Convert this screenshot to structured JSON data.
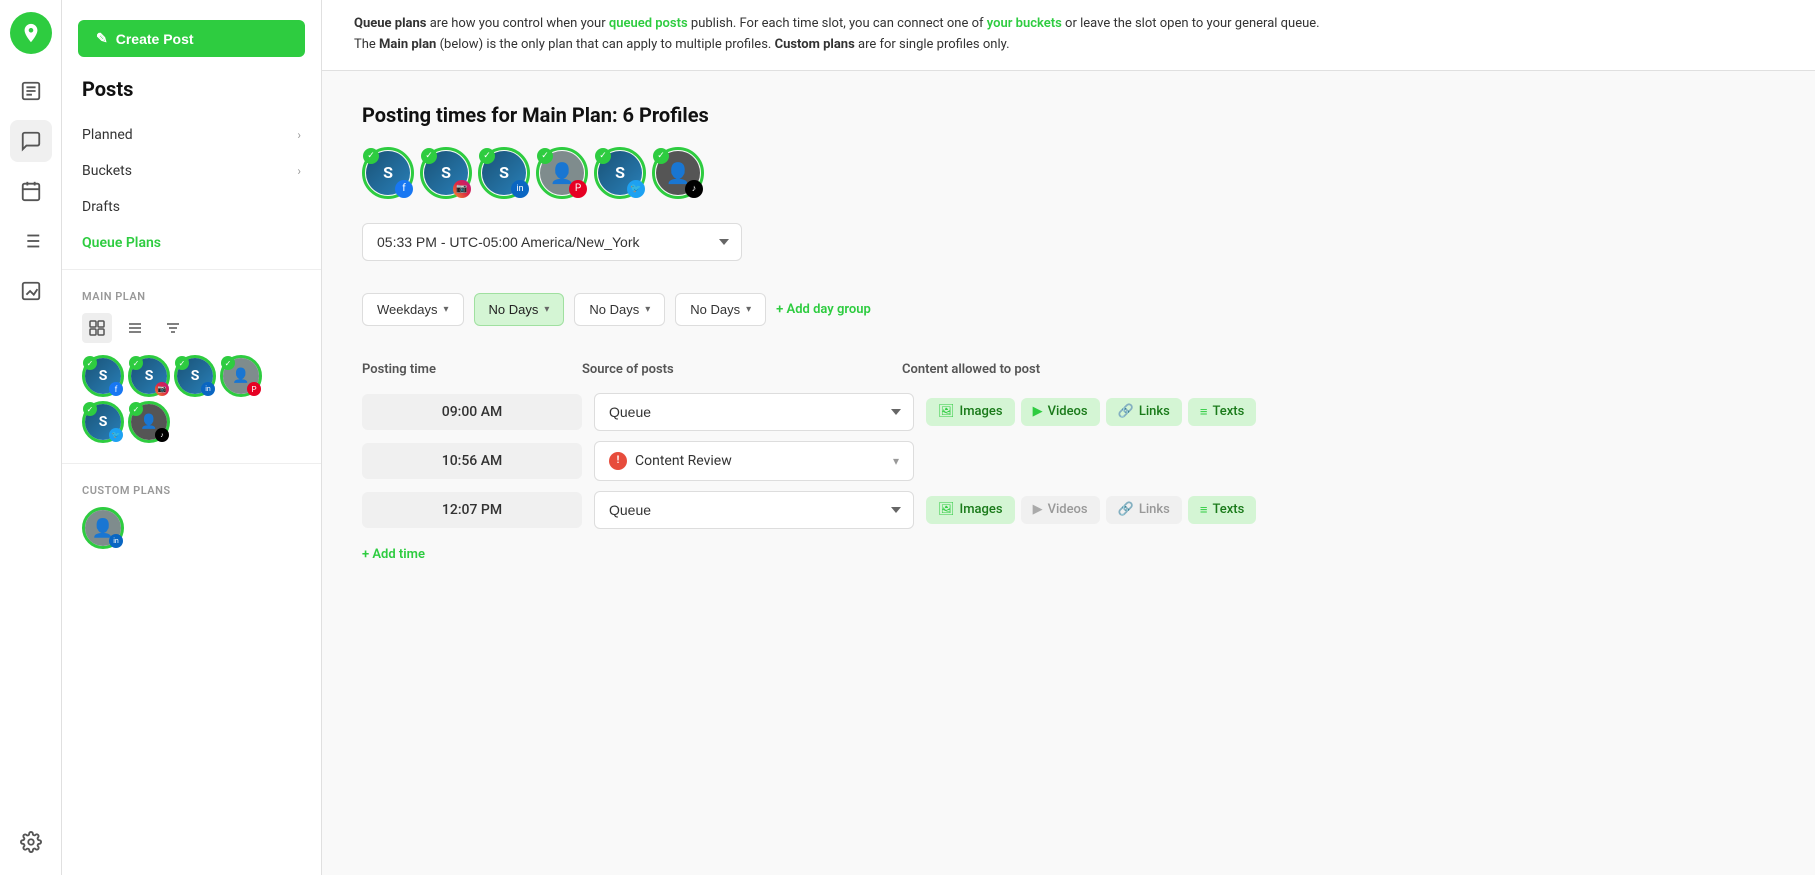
{
  "app": {
    "logo_label": "Logo"
  },
  "sidebar_icons": [
    {
      "name": "location-pin-icon",
      "label": "Location"
    },
    {
      "name": "message-square-icon",
      "label": "Posts"
    },
    {
      "name": "calendar-icon",
      "label": "Calendar"
    },
    {
      "name": "list-icon",
      "label": "Queue Plans"
    },
    {
      "name": "chart-bar-icon",
      "label": "Analytics"
    },
    {
      "name": "settings-icon",
      "label": "Settings"
    }
  ],
  "nav": {
    "create_button": "Create Post",
    "section_title": "Posts",
    "items": [
      {
        "label": "Planned",
        "has_chevron": true,
        "active": false
      },
      {
        "label": "Buckets",
        "has_chevron": true,
        "active": false
      },
      {
        "label": "Drafts",
        "has_chevron": false,
        "active": false
      },
      {
        "label": "Queue Plans",
        "has_chevron": false,
        "active": true
      }
    ]
  },
  "main_plan": {
    "label": "MAIN PLAN",
    "profiles": [
      {
        "initials": "S",
        "social": "fb",
        "social_label": "Facebook"
      },
      {
        "initials": "S",
        "social": "ig",
        "social_label": "Instagram"
      },
      {
        "initials": "S",
        "social": "li",
        "social_label": "LinkedIn"
      },
      {
        "initials": "person",
        "social": "pi",
        "social_label": "Pinterest"
      },
      {
        "initials": "S",
        "social": "tw",
        "social_label": "Twitter"
      },
      {
        "initials": "person2",
        "social": "tk",
        "social_label": "TikTok"
      }
    ]
  },
  "custom_plans": {
    "label": "CUSTOM PLANS",
    "profiles": [
      {
        "initials": "person3",
        "social": "li",
        "social_label": "LinkedIn"
      }
    ]
  },
  "info_banner": {
    "text1": "Queue plans",
    "text2": " are how you control when your ",
    "link1": "queued posts",
    "text3": " publish. For each time slot, you can connect one of ",
    "link2": "your buckets",
    "text4": " or leave the slot open to your general queue. The ",
    "bold1": "Main plan",
    "text5": " (below) is the only plan that can apply to multiple profiles. ",
    "bold2": "Custom plans",
    "text6": " are for single profiles only."
  },
  "posting_times": {
    "heading": "Posting times for  Main Plan: 6 Profiles",
    "timezone": "05:33 PM - UTC-05:00 America/New_York",
    "profiles": [
      {
        "initials": "S",
        "social": "fb"
      },
      {
        "initials": "S",
        "social": "ig"
      },
      {
        "initials": "S",
        "social": "li"
      },
      {
        "initials": "person",
        "social": "pi"
      },
      {
        "initials": "S",
        "social": "tw"
      },
      {
        "initials": "person2",
        "social": "tk"
      }
    ],
    "day_groups": [
      {
        "label": "Weekdays",
        "highlighted": false
      },
      {
        "label": "No Days",
        "highlighted": true
      },
      {
        "label": "No Days",
        "highlighted": false
      },
      {
        "label": "No Days",
        "highlighted": false
      }
    ],
    "add_day_group": "+ Add day group",
    "table_headers": {
      "posting_time": "Posting time",
      "source": "Source of posts",
      "content": "Content allowed to post"
    },
    "rows": [
      {
        "time": "09:00 AM",
        "source": "Queue",
        "source_type": "queue",
        "badges": [
          {
            "label": "Images",
            "icon": "image-icon",
            "active": true
          },
          {
            "label": "Videos",
            "icon": "video-icon",
            "active": true
          },
          {
            "label": "Links",
            "icon": "link-icon",
            "active": true
          },
          {
            "label": "Texts",
            "icon": "text-icon",
            "active": true
          }
        ]
      },
      {
        "time": "10:56 AM",
        "source": "Content Review",
        "source_type": "review",
        "badges": []
      },
      {
        "time": "12:07 PM",
        "source": "Queue",
        "source_type": "queue",
        "badges": [
          {
            "label": "Images",
            "icon": "image-icon",
            "active": true
          },
          {
            "label": "Videos",
            "icon": "video-icon",
            "active": false
          },
          {
            "label": "Links",
            "icon": "link-icon",
            "active": false
          },
          {
            "label": "Texts",
            "icon": "text-icon",
            "active": true
          }
        ]
      }
    ],
    "add_time": "+ Add time"
  }
}
